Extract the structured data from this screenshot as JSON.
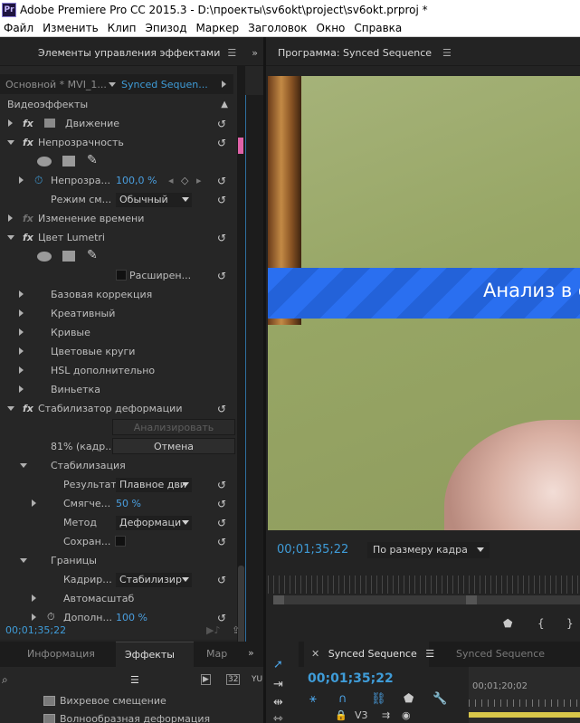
{
  "window": {
    "title": "Adobe Premiere Pro CC 2015.3 - D:\\проекты\\sv6okt\\project\\sv6okt.prproj *",
    "app_icon": "Pr"
  },
  "menu": [
    "Файл",
    "Изменить",
    "Клип",
    "Эпизод",
    "Маркер",
    "Заголовок",
    "Окно",
    "Справка"
  ],
  "effect_controls": {
    "tab_label": "Элементы управления эффектами",
    "source_clip": "Основной * MVI_1...",
    "sequence_clip": "Synced Sequen...",
    "section_header": "Видеоэффекты",
    "rows": {
      "motion": "Движение",
      "opacity": "Непрозрачность",
      "opacity_param": "Непрозра...",
      "opacity_value": "100,0 %",
      "blend_mode_label": "Режим см...",
      "blend_mode_value": "Обычный",
      "time_remap": "Изменение времени",
      "lumetri": "Цвет Lumetri",
      "advanced": "Расширен...",
      "basic_correction": "Базовая коррекция",
      "creative": "Креативный",
      "curves": "Кривые",
      "color_wheels": "Цветовые круги",
      "hsl_secondary": "HSL дополнительно",
      "vignette": "Виньетка",
      "warp_stabilizer": "Стабилизатор деформации",
      "analyze_button": "Анализировать",
      "progress_text": "81% (кадр...",
      "cancel_button": "Отмена",
      "stabilization": "Стабилизация",
      "result_label": "Результат",
      "result_value": "Плавное дви",
      "smoothness_label": "Смягче...",
      "smoothness_value": "50 %",
      "method_label": "Метод",
      "method_value": "Деформаци",
      "preserve_label": "Сохран...",
      "borders": "Границы",
      "framing_label": "Кадрир...",
      "framing_value": "Стабилизир",
      "auto_scale": "Автомасштаб",
      "additional_label": "Дополн...",
      "additional_value": "100 %"
    },
    "timecode": "00;01;35;22"
  },
  "program_monitor": {
    "tab_label": "Программа: Synced Sequence",
    "banner_text": "Анализ в ф",
    "timecode": "00;01;35;22",
    "fit_value": "По размеру кадра"
  },
  "bottom_left": {
    "tabs": [
      "Информация",
      "Эффекты",
      "Мар"
    ],
    "items": [
      "Вихревое смещение",
      "Волнообразная деформация"
    ]
  },
  "timeline": {
    "tabs": [
      "Synced Sequence",
      "Synced Sequence"
    ],
    "timecode": "00;01;35;22",
    "ruler_label": "00;01;20;02",
    "track_label": "V3"
  },
  "colors": {
    "accent_blue": "#3f9cd8",
    "banner_blue": "#2a6ff0",
    "work_area": "#d8c64a"
  }
}
